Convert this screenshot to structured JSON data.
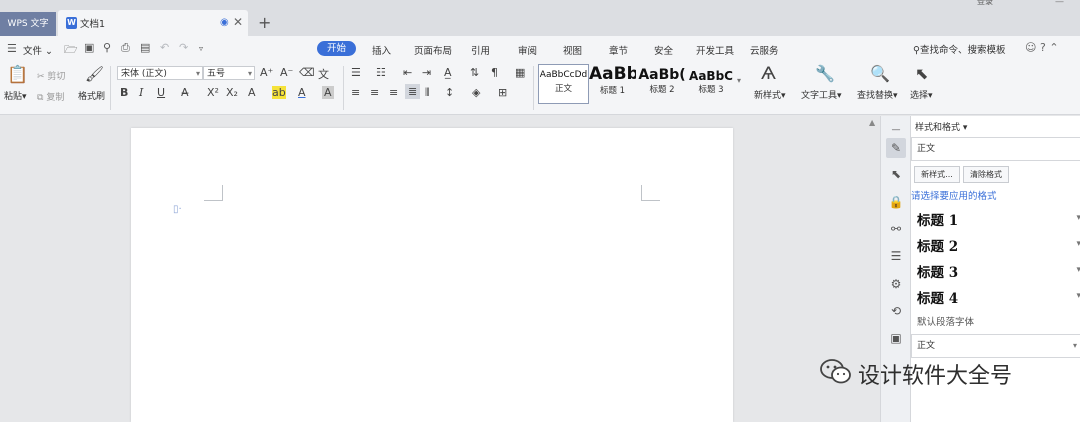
{
  "tabbar": {
    "app_tab": "WPS 文字",
    "doc_tab_title": "文档1",
    "add_tab": "+",
    "login": "登录",
    "window_min": "—"
  },
  "menu": {
    "file_label": "文件",
    "tabs": [
      "开始",
      "插入",
      "页面布局",
      "引用",
      "审阅",
      "视图",
      "章节",
      "安全",
      "开发工具",
      "云服务"
    ],
    "active_tab": "开始",
    "search_label": "查找命令、搜索模板"
  },
  "ribbon": {
    "paste_label": "粘贴",
    "cut_label": "剪切",
    "copy_label": "复制",
    "format_painter_label": "格式刷",
    "font_name": "宋体 (正文)",
    "font_size": "五号",
    "styles": [
      {
        "sample": "AaBbCcDd",
        "name": "正文"
      },
      {
        "sample": "AaBb",
        "name": "标题 1"
      },
      {
        "sample": "AaBb(",
        "name": "标题 2"
      },
      {
        "sample": "AaBbC",
        "name": "标题 3"
      }
    ],
    "new_style_label": "新样式",
    "text_tools_label": "文字工具",
    "find_replace_label": "查找替换",
    "select_label": "选择"
  },
  "style_pane": {
    "title": "样式和格式",
    "current_style": "正文",
    "new_style_button": "新样式...",
    "clear_format_button": "清除格式",
    "hint": "请选择要应用的格式",
    "items": [
      "标题 1",
      "标题 2",
      "标题 3",
      "标题 4"
    ],
    "default_font": "默认段落字体",
    "footer_style": "正文"
  },
  "watermark": {
    "text": "设计软件大全号"
  },
  "colors": {
    "accent": "#3a6fd8",
    "app_tab_bg": "#6f7fa3",
    "canvas_bg": "#e6e7e9"
  }
}
